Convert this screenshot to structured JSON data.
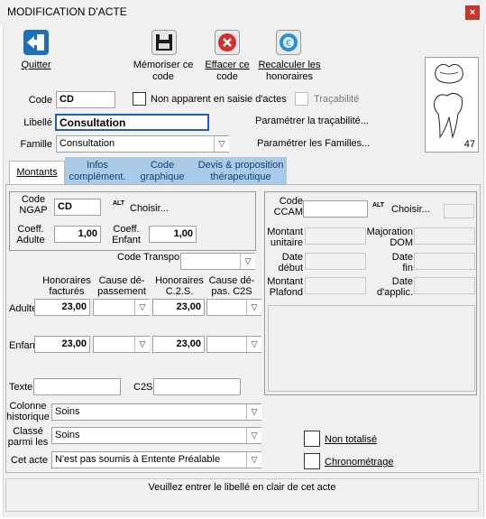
{
  "window": {
    "title": "MODIFICATION D'ACTE",
    "close": "×"
  },
  "toolbar": {
    "quit": "Quitter",
    "save_line1": "Mémoriser ce",
    "save_line2": "code",
    "delete_line1": "Effacer ce",
    "delete_line2": "code",
    "recalc_line1": "Recalculer les",
    "recalc_line2": "honoraires"
  },
  "tooth": {
    "number": "47"
  },
  "form": {
    "code_label": "Code",
    "code_value": "CD",
    "not_shown_label": "Non apparent en saisie d'actes",
    "traceability_label": "Traçabilité",
    "libelle_label": "Libellé",
    "libelle_value": "Consultation",
    "param_traceability": "Paramétrer la traçabilité...",
    "famille_label": "Famille",
    "famille_value": "Consultation",
    "param_families": "Paramétrer les Familles..."
  },
  "tabs": {
    "montants": "Montants",
    "infos_l1": "Infos",
    "infos_l2": "complément.",
    "code_l1": "Code",
    "code_l2": "graphique",
    "devis_l1": "Devis & proposition",
    "devis_l2": "thérapeutique"
  },
  "ngap": {
    "code_l1": "Code",
    "code_l2": "NGAP",
    "code_value": "CD",
    "alt": "ALT",
    "choose": "Choisir...",
    "coeff_adult_l1": "Coeff.",
    "coeff_adult_l2": "Adulte",
    "coeff_adult_value": "1,00",
    "coeff_child_l1": "Coeff.",
    "coeff_child_l2": "Enfant",
    "coeff_child_value": "1,00"
  },
  "ccam": {
    "code_l1": "Code",
    "code_l2": "CCAM",
    "alt": "ALT",
    "choose": "Choisir...",
    "montant_unitaire_l1": "Montant",
    "montant_unitaire_l2": "unitaire",
    "majoration_l1": "Majoration",
    "majoration_l2": "DOM",
    "date_debut_l1": "Date",
    "date_debut_l2": "début",
    "date_fin_l1": "Date",
    "date_fin_l2": "fin",
    "montant_plafond_l1": "Montant",
    "montant_plafond_l2": "Plafond",
    "date_applic_l1": "Date",
    "date_applic_l2": "d'applic."
  },
  "fees": {
    "code_transpo": "Code Transpo",
    "col_honoraires_l1": "Honoraires",
    "col_honoraires_l2": "facturés",
    "col_cause_l1": "Cause dé-",
    "col_cause_l2": "passement",
    "col_c2s_l1": "Honoraires",
    "col_c2s_l2": "C.2.S.",
    "col_cause_c2s_l1": "Cause dé-",
    "col_cause_c2s_l2": "pas. C2S",
    "adult_label": "Adulte",
    "adult_honoraires": "23,00",
    "adult_c2s": "23,00",
    "child_label": "Enfant",
    "child_honoraires": "23,00",
    "child_c2s": "23,00"
  },
  "bottom": {
    "texte": "Texte",
    "c2s": "C2S",
    "colonne_l1": "Colonne",
    "colonne_l2": "historique",
    "colonne_value": "Soins",
    "classe_l1": "Classé",
    "classe_l2": "parmi les",
    "classe_value": "Soins",
    "cet_acte": "Cet acte",
    "cet_acte_value": "N'est pas soumis à Entente Préalable",
    "non_totalise": "Non totalisé",
    "chronometrage": "Chronométrage"
  },
  "status": {
    "message": "Veuillez entrer le libellé en clair de cet acte"
  },
  "colors": {
    "tab": "#a8cce8",
    "tab_text": "#1b3e78",
    "quit_icon": "#1f6fb8",
    "delete_icon": "#d03030",
    "recalc_icon": "#2c8fd0"
  }
}
